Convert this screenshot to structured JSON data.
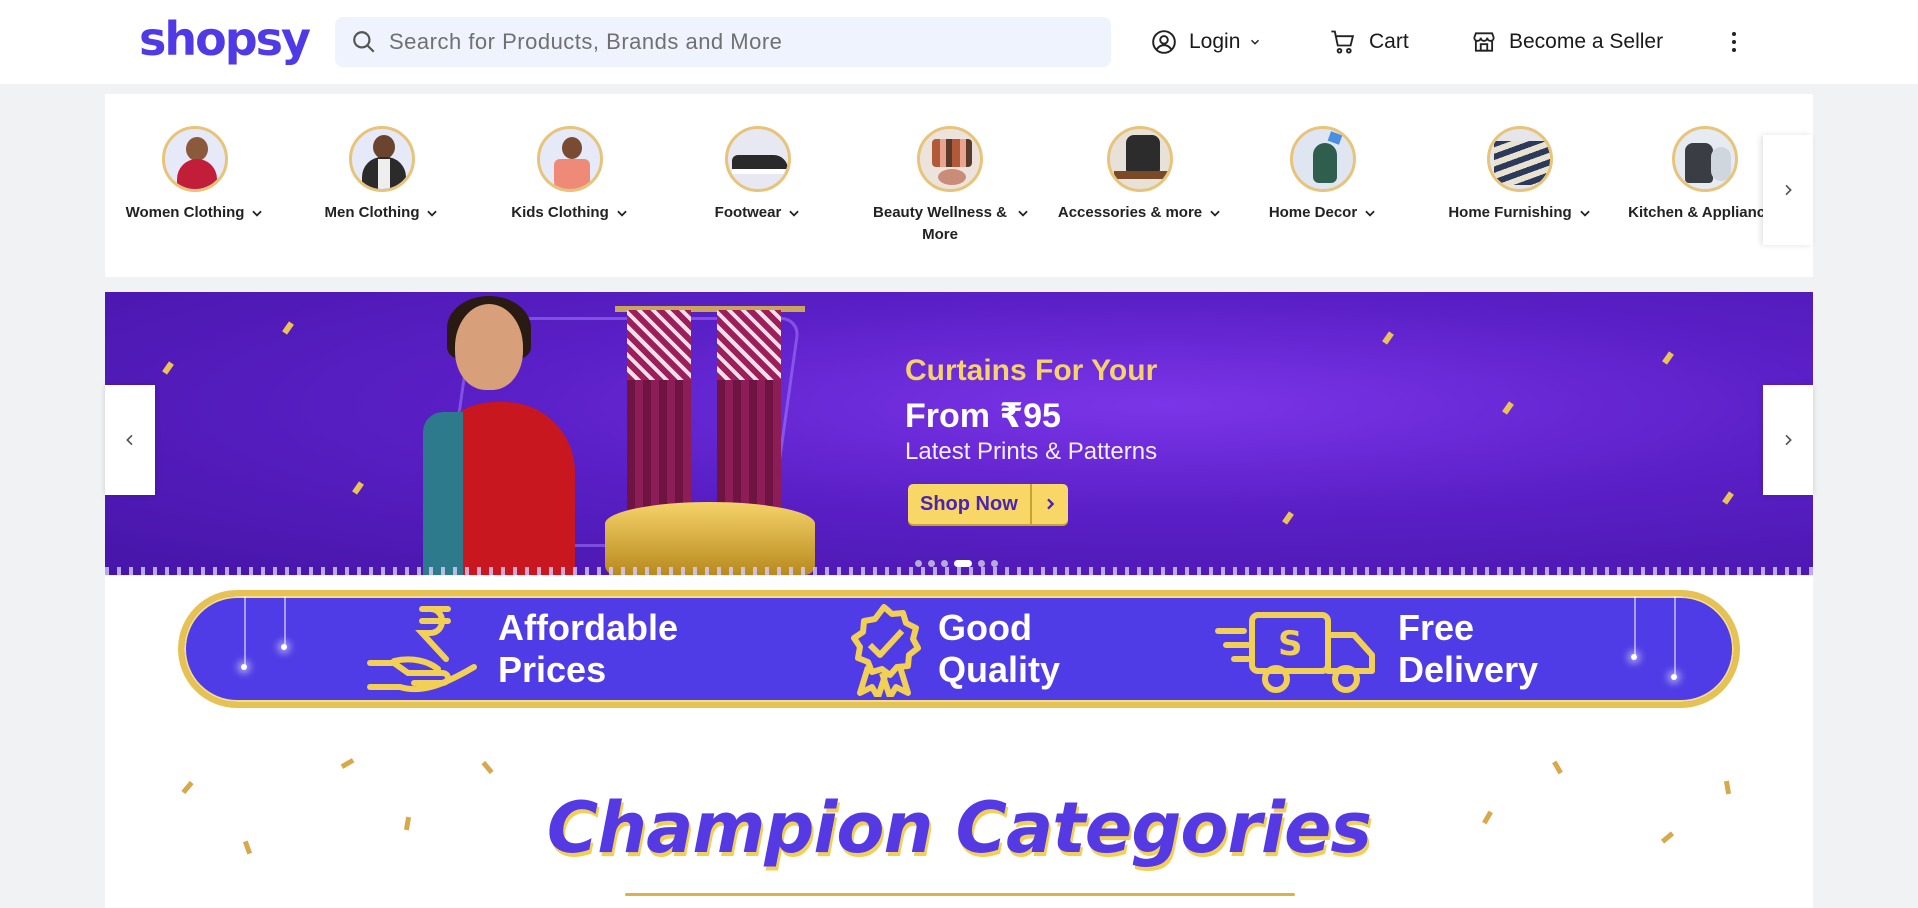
{
  "header": {
    "logo": "shopsy",
    "search_placeholder": "Search for Products, Brands and More",
    "login_label": "Login",
    "cart_label": "Cart",
    "seller_label": "Become a Seller"
  },
  "categories": [
    {
      "label": "Women Clothing",
      "icon": "women-clothing-thumb",
      "chevron": true
    },
    {
      "label": "Men Clothing",
      "icon": "men-clothing-thumb",
      "chevron": true
    },
    {
      "label": "Kids Clothing",
      "icon": "kids-clothing-thumb",
      "chevron": true
    },
    {
      "label": "Footwear",
      "icon": "footwear-thumb",
      "chevron": true
    },
    {
      "label": "Beauty Wellness & More",
      "icon": "beauty-thumb",
      "chevron": true
    },
    {
      "label": "Accessories & more",
      "icon": "accessories-thumb",
      "chevron": true
    },
    {
      "label": "Home Decor",
      "icon": "home-decor-thumb",
      "chevron": true
    },
    {
      "label": "Home Furnishing",
      "icon": "home-furnishing-thumb",
      "chevron": true
    },
    {
      "label": "Kitchen & Appliances",
      "icon": "kitchen-thumb",
      "chevron": false
    }
  ],
  "banner": {
    "line1": "Curtains For Your",
    "line2": "From ₹95",
    "line3": "Latest Prints & Patterns",
    "cta": "Shop Now",
    "slide_count": 6,
    "active_slide": 3
  },
  "values": [
    {
      "line1": "Affordable",
      "line2": "Prices",
      "icon": "rupee-hand-icon"
    },
    {
      "line1": "Good",
      "line2": "Quality",
      "icon": "quality-badge-icon"
    },
    {
      "line1": "Free",
      "line2": "Delivery",
      "icon": "delivery-truck-icon"
    }
  ],
  "section": {
    "title": "Champion Categories"
  },
  "colors": {
    "brand": "#4f3ae6",
    "gold": "#e6c153",
    "banner_purple": "#5a1fc6"
  }
}
